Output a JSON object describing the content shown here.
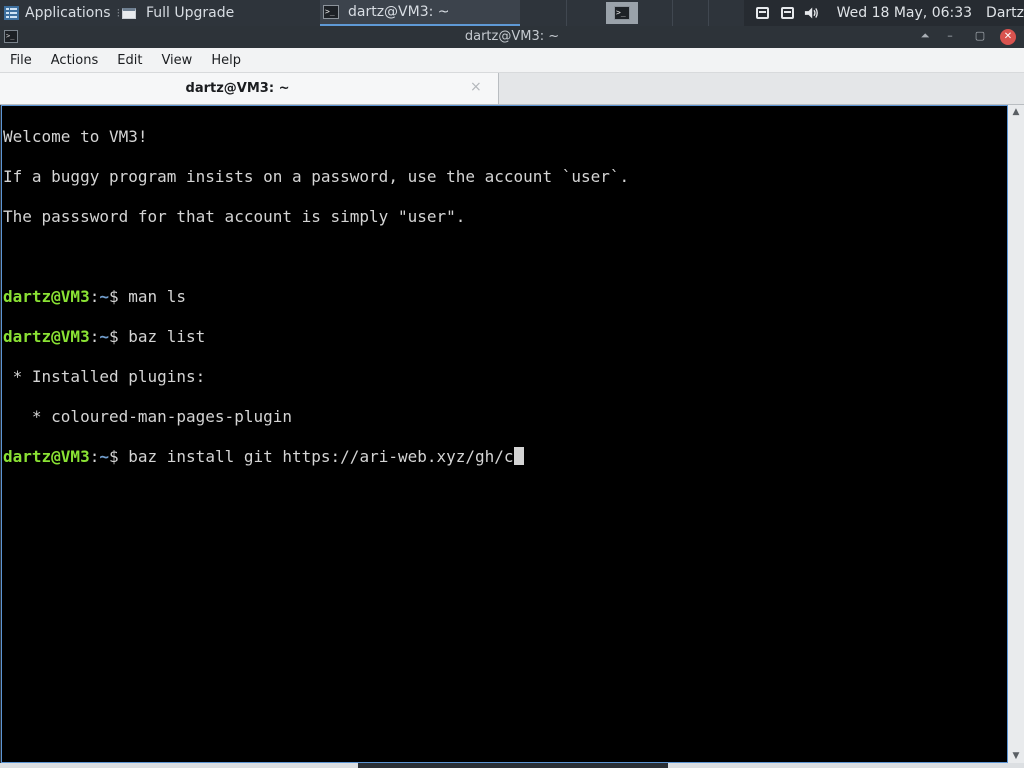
{
  "panel": {
    "applications_label": "Applications",
    "tasks": [
      {
        "label": "Full Upgrade"
      },
      {
        "label": "dartz@VM3: ~"
      }
    ],
    "clock": "Wed 18 May, 06:33",
    "user": "Dartz",
    "icons": [
      "applications-menu-icon",
      "window-icon",
      "terminal-icon",
      "workspace-terminal-icon",
      "notes-icon",
      "document-icon",
      "volume-icon"
    ]
  },
  "window": {
    "title": "dartz@VM3: ~",
    "buttons": [
      "⏶",
      "–",
      "▢",
      "✕"
    ]
  },
  "menubar": [
    "File",
    "Actions",
    "Edit",
    "View",
    "Help"
  ],
  "tabs": [
    {
      "label": "dartz@VM3: ~",
      "close": "×"
    }
  ],
  "terminal": {
    "welcome": "Welcome to VM3!",
    "line2": "If a buggy program insists on a password, use the account `user`.",
    "line3": "The passsword for that account is simply \"user\".",
    "prompt_user": "dartz@VM3",
    "prompt_sep": ":",
    "prompt_path": "~",
    "prompt_dollar": "$ ",
    "cmd1": "man ls",
    "cmd2": "baz list",
    "out1": " * Installed plugins:",
    "out2": "   * coloured-man-pages-plugin",
    "cmd3": "baz install git https://ari-web.xyz/gh/c"
  },
  "colors": {
    "prompt_user": "#8ae234",
    "prompt_path": "#729fcf",
    "terminal_bg": "#000000",
    "focus_border": "#5c95d4"
  }
}
